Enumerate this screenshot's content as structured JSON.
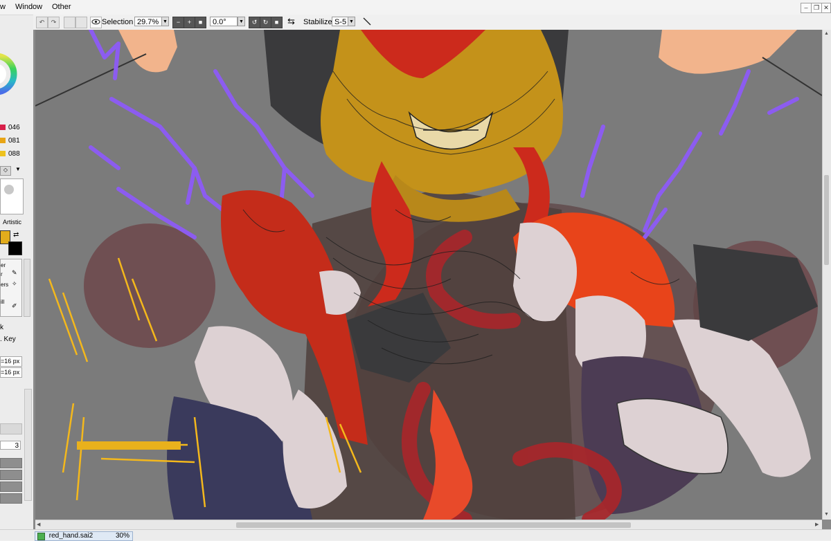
{
  "menu": {
    "items": [
      "w",
      "Window",
      "Other"
    ]
  },
  "toolbar": {
    "selection_label": "Selection",
    "zoom": "29.7%",
    "rotation": "0.0°",
    "stabilizer_label": "Stabilizer",
    "stabilizer_value": "S-5"
  },
  "left_panel": {
    "color_values": [
      "046",
      "081",
      "088"
    ],
    "mode_label": "Artistic",
    "tool_labels": [
      "er",
      "r",
      "ers",
      "ill"
    ],
    "lock_labels": [
      "k",
      ". Key"
    ],
    "size_values": [
      "=16 px",
      "=16 px"
    ],
    "panel_number": "3"
  },
  "document": {
    "tab_name": "red_hand.sai2",
    "zoom_badge": "30%"
  },
  "colors": {
    "canvas_bg": "#7b7b7b",
    "hair_red": "#d93b1c",
    "armor_gold": "#c4921a",
    "lightning_purple": "#8c5cf0",
    "sparks_yellow": "#f4b81c",
    "primary_color": "#e2ac1c",
    "secondary_color": "#000000"
  }
}
